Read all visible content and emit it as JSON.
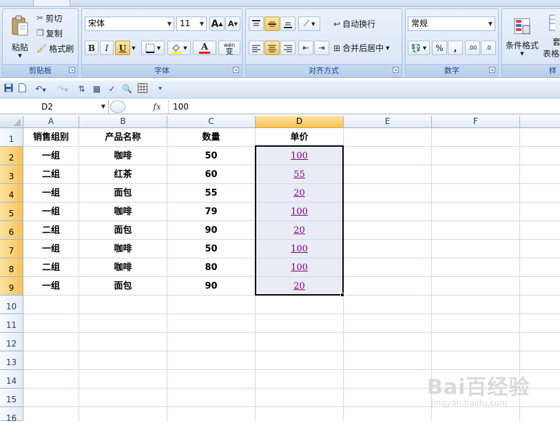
{
  "ribbon": {
    "clipboard": {
      "paste_label": "粘贴",
      "cut_label": "剪切",
      "copy_label": "复制",
      "format_painter_label": "格式刷",
      "group_label": "剪贴板"
    },
    "font": {
      "font_name": "宋体",
      "font_size": "11",
      "grow_label": "A",
      "shrink_label": "A",
      "bold_label": "B",
      "italic_label": "I",
      "underline_label": "U",
      "font_color_label": "A",
      "phonetic_label": "wén",
      "phonetic_sub": "变",
      "group_label": "字体"
    },
    "alignment": {
      "wrap_text_label": "自动换行",
      "merge_center_label": "合并后居中",
      "group_label": "对齐方式"
    },
    "number": {
      "format_value": "常规",
      "percent_label": "%",
      "comma_label": ",",
      "increase_decimal_label": ".00",
      "decrease_decimal_label": ".0",
      "group_label": "数字"
    },
    "styles": {
      "conditional_format_label": "条件格式",
      "table_format_label_1": "套",
      "table_format_label_2": "表格格",
      "group_label": "样"
    }
  },
  "formula_bar": {
    "name_box": "D2",
    "fx_label": "fx",
    "value": "100"
  },
  "sheet": {
    "columns": [
      "A",
      "B",
      "C",
      "D",
      "E",
      "F"
    ],
    "rows": [
      "1",
      "2",
      "3",
      "4",
      "5",
      "6",
      "7",
      "8",
      "9",
      "10",
      "11",
      "12",
      "13",
      "14",
      "15",
      "16"
    ],
    "headers": [
      "销售组别",
      "产品名称",
      "数量",
      "单价"
    ],
    "data": [
      [
        "一组",
        "咖啡",
        "50",
        "100"
      ],
      [
        "二组",
        "红茶",
        "60",
        "55"
      ],
      [
        "一组",
        "面包",
        "55",
        "20"
      ],
      [
        "一组",
        "咖啡",
        "79",
        "100"
      ],
      [
        "二组",
        "面包",
        "90",
        "20"
      ],
      [
        "一组",
        "咖啡",
        "50",
        "100"
      ],
      [
        "二组",
        "咖啡",
        "80",
        "100"
      ],
      [
        "一组",
        "面包",
        "90",
        "20"
      ]
    ],
    "selected_column": "D",
    "link_color": "#800080",
    "selection_fill": "#e9ecf5"
  },
  "watermark": {
    "logo": "Bai百经验",
    "url": "jingyan.baidu.com"
  }
}
